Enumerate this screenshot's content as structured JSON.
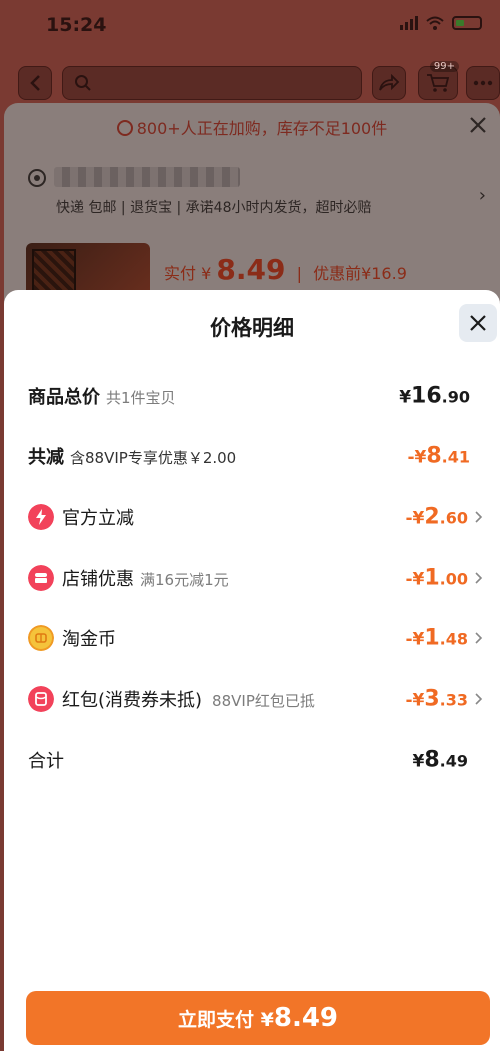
{
  "status": {
    "time": "15:24"
  },
  "nav": {
    "cart_badge": "99+"
  },
  "under_sheet": {
    "stock_notice": "800+人正在加购，库存不足100件",
    "shipping_line": "快递 包邮 | 退货宝 | 承诺48小时内发货，超时必赔",
    "price": {
      "label": "实付",
      "currency": "¥",
      "value": "8.49",
      "separator": "|",
      "before_label": "优惠前¥16.9"
    }
  },
  "sheet": {
    "title": "价格明细",
    "rows": [
      {
        "label": "商品总价",
        "sub": "共1件宝贝",
        "currency": "¥",
        "amount_big": "16",
        "amount_small": ".90"
      },
      {
        "label": "共减",
        "sub": "含88VIP专享优惠￥2.00",
        "currency": "-¥",
        "amount_big": "8",
        "amount_small": ".41"
      },
      {
        "label": "官方立减",
        "sub": "",
        "currency": "-¥",
        "amount_big": "2",
        "amount_small": ".60"
      },
      {
        "label": "店铺优惠",
        "sub": "满16元减1元",
        "currency": "-¥",
        "amount_big": "1",
        "amount_small": ".00"
      },
      {
        "label": "淘金币",
        "sub": "",
        "currency": "-¥",
        "amount_big": "1",
        "amount_small": ".48"
      },
      {
        "label": "红包(消费券未抵)",
        "sub": "88VIP红包已抵",
        "currency": "-¥",
        "amount_big": "3",
        "amount_small": ".33"
      },
      {
        "label": "合计",
        "sub": "",
        "currency": "¥",
        "amount_big": "8",
        "amount_small": ".49"
      }
    ]
  },
  "pay_button": {
    "label": "立即支付",
    "currency": "¥",
    "value": "8.49"
  },
  "colors": {
    "accent_orange": "#f27528",
    "discount_orange": "#f06a23",
    "red_icon": "#f2425a"
  },
  "icons": [
    "back-icon",
    "search-icon",
    "share-icon",
    "cart-icon",
    "more-icon",
    "alarm-icon",
    "close-icon",
    "location-pin-icon",
    "lightning-icon",
    "shop-icon",
    "coin-icon",
    "red-packet-icon",
    "chevron-right-icon"
  ]
}
